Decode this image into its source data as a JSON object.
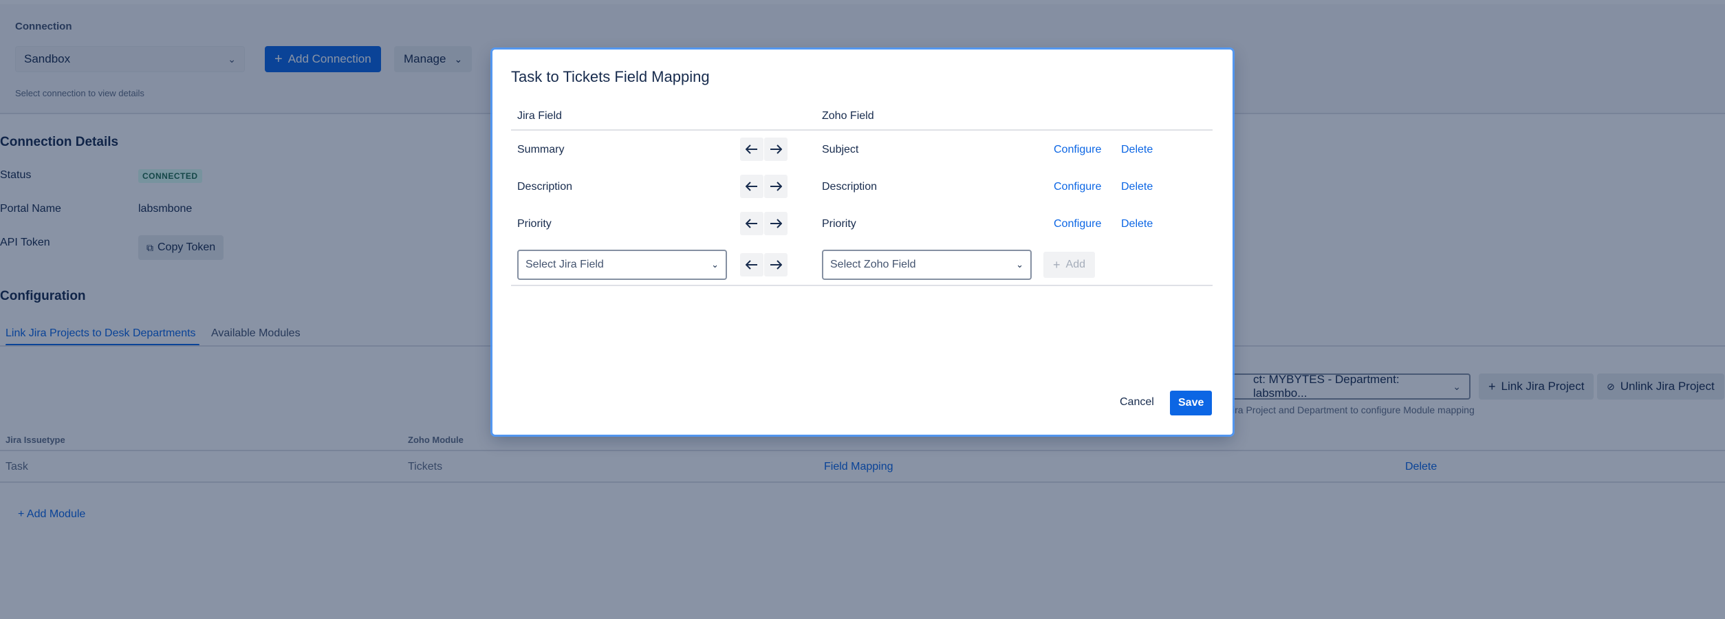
{
  "connection": {
    "label": "Connection",
    "selected": "Sandbox",
    "add_label": "Add Connection",
    "manage_label": "Manage",
    "hint": "Select connection to view details"
  },
  "details": {
    "title": "Connection Details",
    "status_key": "Status",
    "status_val": "CONNECTED",
    "portal_key": "Portal Name",
    "portal_val": "labsmbone",
    "token_key": "API Token",
    "copy_label": "Copy Token"
  },
  "configuration": {
    "title": "Configuration",
    "tabs": [
      {
        "label": "Link Jira Projects to Desk Departments"
      },
      {
        "label": "Available Modules"
      }
    ],
    "project_select": "ct: MYBYTES - Department: labsmbo...",
    "link_label": "Link Jira Project",
    "unlink_label": "Unlink Jira Project",
    "project_hint": "Jira Project and Department to configure Module mapping"
  },
  "module_table": {
    "headers": [
      "Jira Issuetype",
      "Zoho Module"
    ],
    "rows": [
      {
        "issuetype": "Task",
        "module": "Tickets",
        "mapping": "Field Mapping",
        "delete": "Delete"
      }
    ],
    "add_module": "+ Add Module"
  },
  "modal": {
    "title": "Task to Tickets Field Mapping",
    "jira_head": "Jira Field",
    "zoho_head": "Zoho Field",
    "rows": [
      {
        "jira": "Summary",
        "zoho": "Subject",
        "configure": "Configure",
        "delete": "Delete"
      },
      {
        "jira": "Description",
        "zoho": "Description",
        "configure": "Configure",
        "delete": "Delete"
      },
      {
        "jira": "Priority",
        "zoho": "Priority",
        "configure": "Configure",
        "delete": "Delete"
      }
    ],
    "jira_select_placeholder": "Select Jira Field",
    "zoho_select_placeholder": "Select Zoho Field",
    "add_label": "Add",
    "cancel_label": "Cancel",
    "save_label": "Save"
  },
  "colors": {
    "primary": "#0c66e4",
    "overlay": "#091e42",
    "connected": "#216e4e"
  }
}
